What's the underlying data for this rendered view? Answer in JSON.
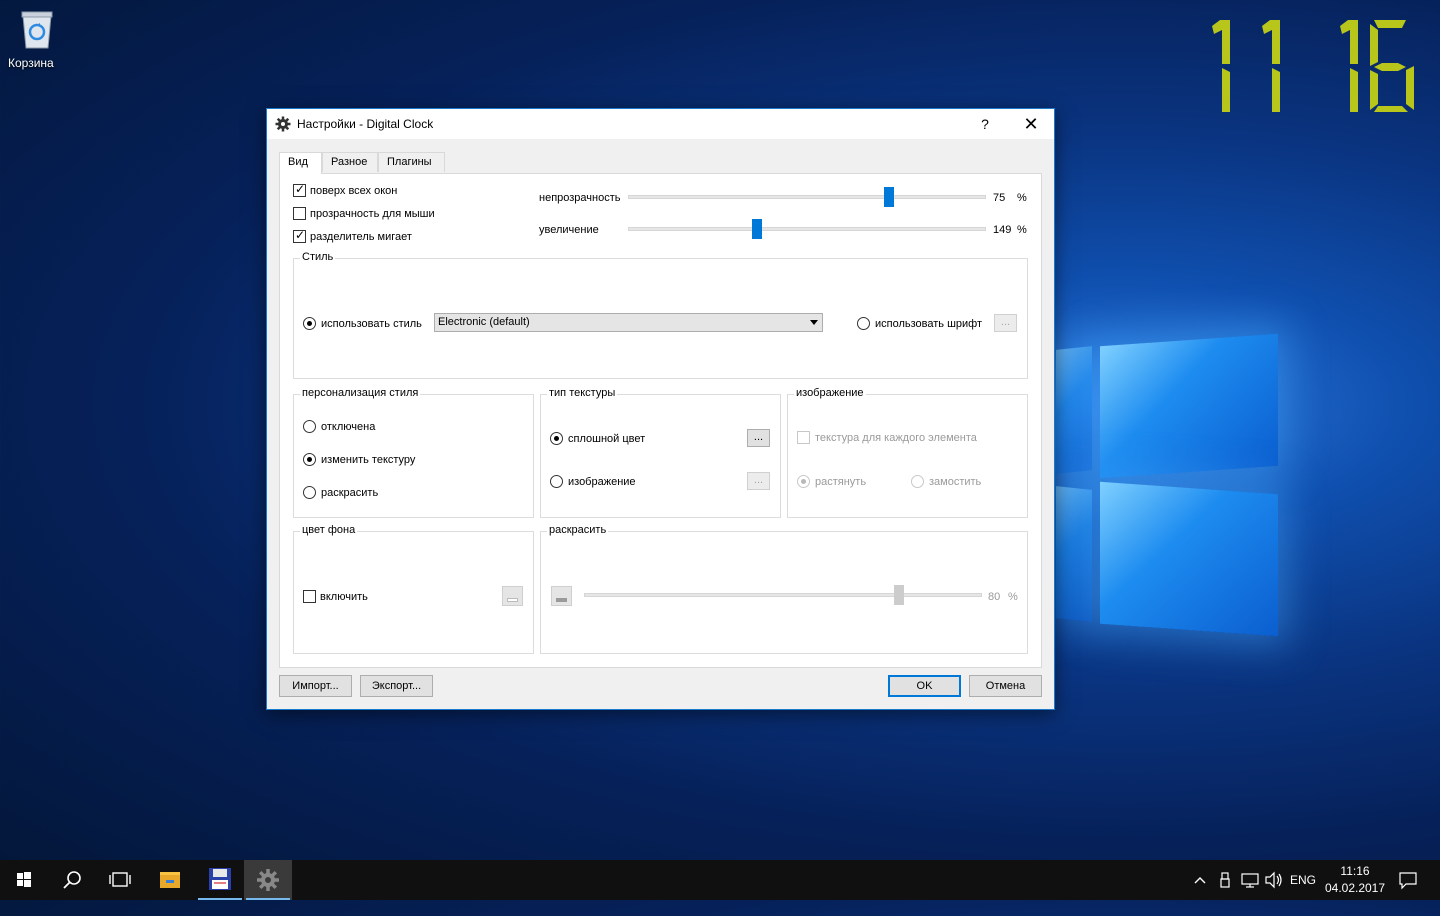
{
  "desktop": {
    "recycle_bin_label": "Корзина",
    "clock_time": "11 16",
    "clock_color": "#b8c51b"
  },
  "dialog": {
    "title": "Настройки - Digital Clock",
    "help_label": "?",
    "close_label": "✕",
    "tabs": [
      {
        "label": "Вид",
        "active": true
      },
      {
        "label": "Разное",
        "active": false
      },
      {
        "label": "Плагины",
        "active": false
      }
    ],
    "checks": {
      "always_on_top": {
        "label": "поверх всех окон",
        "checked": true
      },
      "mouse_transparency": {
        "label": "прозрачность для мыши",
        "checked": false
      },
      "separator_blinks": {
        "label": "разделитель мигает",
        "checked": true
      }
    },
    "opacity": {
      "label": "непрозрачность",
      "value": "75",
      "unit": "%",
      "fraction": 0.72
    },
    "zoom": {
      "label": "увеличение",
      "value": "149",
      "unit": "%",
      "fraction": 0.36
    },
    "style_group": {
      "title": "Стиль",
      "use_style_label": "использовать стиль",
      "use_style_checked": true,
      "style_value": "Electronic (default)",
      "use_font_label": "использовать шрифт",
      "use_font_checked": false,
      "font_button": "..."
    },
    "customization": {
      "title": "персонализация стиля",
      "options": [
        {
          "label": "отключена",
          "checked": false
        },
        {
          "label": "изменить текстуру",
          "checked": true
        },
        {
          "label": "раскрасить",
          "checked": false
        }
      ]
    },
    "texture_type": {
      "title": "тип текстуры",
      "solid_label": "сплошной цвет",
      "solid_checked": true,
      "solid_button": "...",
      "image_label": "изображение",
      "image_checked": false,
      "image_button": "..."
    },
    "image_group": {
      "title": "изображение",
      "per_element_label": "текстура для каждого элемента",
      "stretch_label": "растянуть",
      "tile_label": "замостить"
    },
    "bg_color": {
      "title": "цвет фона",
      "enable_label": "включить",
      "enable_checked": false
    },
    "colorize": {
      "title": "раскрасить",
      "value": "80",
      "unit": "%",
      "fraction": 0.79
    },
    "buttons": {
      "import": "Импорт...",
      "export": "Экспорт...",
      "ok": "OK",
      "cancel": "Отмена"
    }
  },
  "taskbar": {
    "language": "ENG",
    "time": "11:16",
    "date": "04.02.2017"
  }
}
